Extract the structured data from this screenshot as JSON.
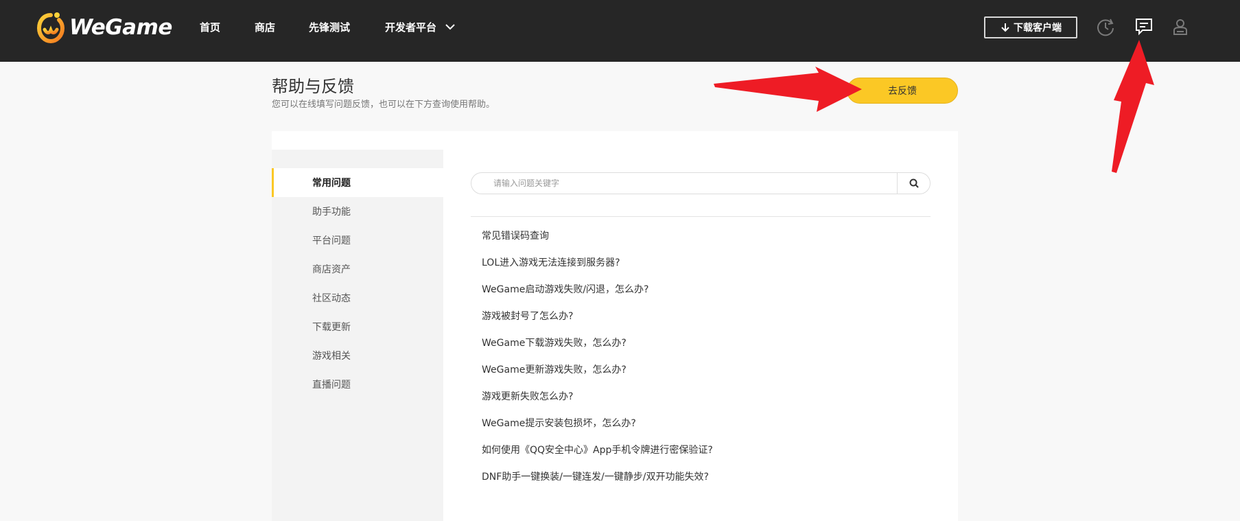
{
  "topbar": {
    "brand": "WeGame",
    "nav": [
      {
        "label": "首页"
      },
      {
        "label": "商店"
      },
      {
        "label": "先锋测试"
      },
      {
        "label": "开发者平台"
      }
    ],
    "download_label": "下载客户端",
    "icons": [
      "history-icon",
      "feedback-icon",
      "user-icon"
    ]
  },
  "page": {
    "title": "帮助与反馈",
    "subtitle": "您可以在线填写问题反馈，也可以在下方查询使用帮助。",
    "feedback_button": "去反馈"
  },
  "sidebar": {
    "items": [
      {
        "label": "常用问题",
        "active": true
      },
      {
        "label": "助手功能"
      },
      {
        "label": "平台问题"
      },
      {
        "label": "商店资产"
      },
      {
        "label": "社区动态"
      },
      {
        "label": "下载更新"
      },
      {
        "label": "游戏相关"
      },
      {
        "label": "直播问题"
      }
    ]
  },
  "search": {
    "placeholder": "请输入问题关键字",
    "value": ""
  },
  "faq": [
    "常见错误码查询",
    "LOL进入游戏无法连接到服务器?",
    "WeGame启动游戏失败/闪退，怎么办?",
    "游戏被封号了怎么办?",
    "WeGame下载游戏失败，怎么办?",
    "WeGame更新游戏失败，怎么办?",
    "游戏更新失败怎么办?",
    "WeGame提示安装包损坏，怎么办?",
    "如何使用《QQ安全中心》App手机令牌进行密保验证?",
    "DNF助手一键换装/一键连发/一键静步/双开功能失效?"
  ],
  "colors": {
    "topbar_bg": "#262626",
    "accent": "#fbc825",
    "annotation_arrow": "#ee1c25"
  }
}
